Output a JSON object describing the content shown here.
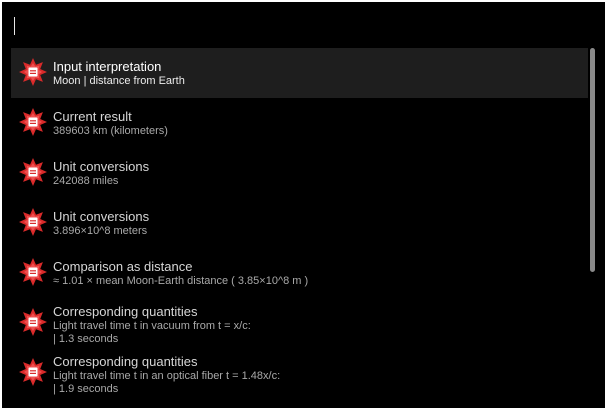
{
  "search": {
    "value": "",
    "placeholder": ""
  },
  "results": [
    {
      "title": "Input interpretation",
      "lines": [
        "Moon | distance from Earth"
      ],
      "selected": true
    },
    {
      "title": "Current result",
      "lines": [
        "389603 km (kilometers)"
      ]
    },
    {
      "title": "Unit conversions",
      "lines": [
        "242088 miles"
      ]
    },
    {
      "title": "Unit conversions",
      "lines": [
        "3.896×10^8 meters"
      ]
    },
    {
      "title": "Comparison as distance",
      "lines": [
        "≈ 1.01 × mean Moon-Earth distance ( 3.85×10^8 m )"
      ]
    },
    {
      "title": "Corresponding quantities",
      "lines": [
        "Light travel time t in vacuum from t = x/c:",
        " | 1.3 seconds"
      ]
    },
    {
      "title": "Corresponding quantities",
      "lines": [
        "Light travel time t in an optical fiber t = 1.48x/c:",
        " | 1.9 seconds"
      ]
    }
  ],
  "icon": {
    "name": "wolfram-alpha-icon",
    "star_color": "#d92a2a",
    "star_highlight": "#f25a5a",
    "center_color": "#ffffff"
  },
  "colors": {
    "background": "#000000",
    "selected_row": "#1e1e1e",
    "scroll_thumb": "#8a8a8a"
  }
}
